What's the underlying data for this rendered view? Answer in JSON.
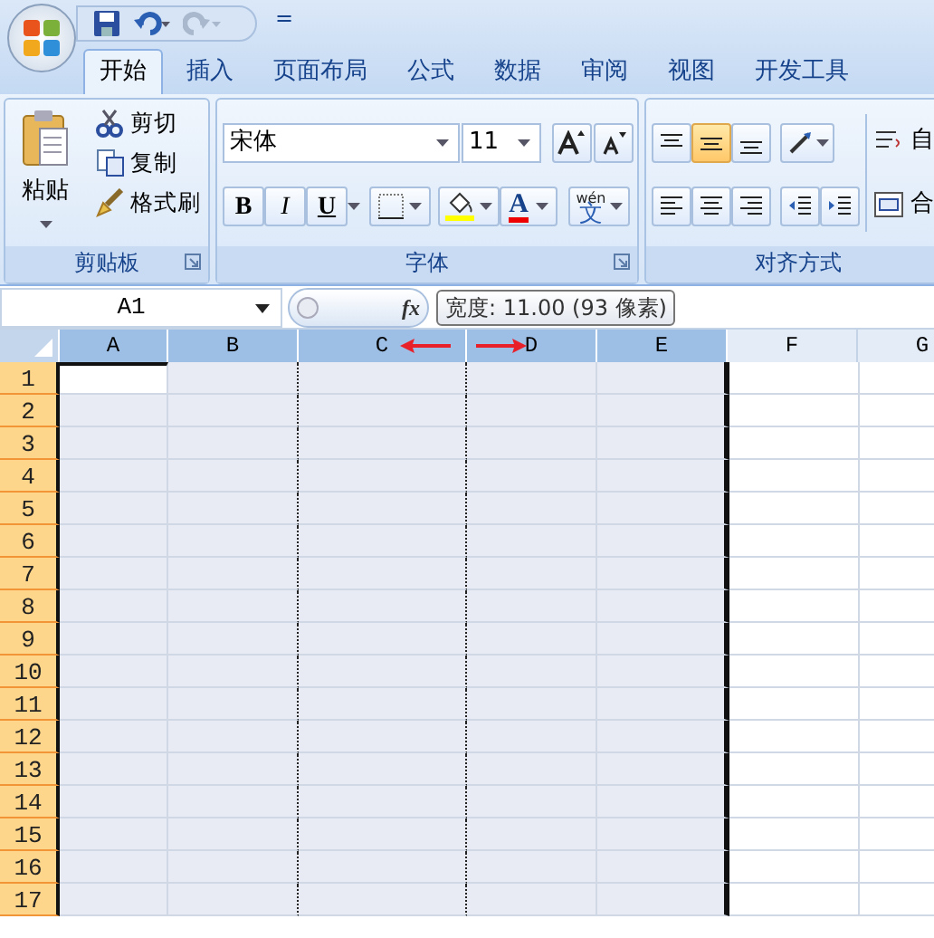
{
  "quick_access": {
    "overflow": "="
  },
  "tabs": [
    {
      "label": "开始",
      "selected": true
    },
    {
      "label": "插入",
      "selected": false
    },
    {
      "label": "页面布局",
      "selected": false
    },
    {
      "label": "公式",
      "selected": false
    },
    {
      "label": "数据",
      "selected": false
    },
    {
      "label": "审阅",
      "selected": false
    },
    {
      "label": "视图",
      "selected": false
    },
    {
      "label": "开发工具",
      "selected": false
    }
  ],
  "clipboard": {
    "paste": "粘贴",
    "commands": [
      "剪切",
      "复制",
      "格式刷"
    ],
    "label": "剪贴板"
  },
  "font": {
    "name": "宋体",
    "size": "11",
    "styles": [
      "B",
      "I",
      "U"
    ],
    "color_label": "A",
    "phonetic": "wén",
    "phonetic_char": "文",
    "label": "字体"
  },
  "alignment": {
    "vertical": [
      {
        "selected": false
      },
      {
        "selected": true
      },
      {
        "selected": false
      }
    ],
    "wrap": "自",
    "merge": "合",
    "label": "对齐方式"
  },
  "formula_bar": {
    "name_box": "A1",
    "fx": "fx",
    "tooltip": "宽度: 11.00 (93 像素)"
  },
  "columns": [
    {
      "label": "A",
      "selected": true,
      "active": true
    },
    {
      "label": "B",
      "selected": true,
      "active": false
    },
    {
      "label": "C",
      "selected": true,
      "active": false
    },
    {
      "label": "D",
      "selected": true,
      "active": false
    },
    {
      "label": "E",
      "selected": true,
      "active": false
    },
    {
      "label": "F",
      "selected": false,
      "active": false
    },
    {
      "label": "G",
      "selected": false,
      "active": false
    }
  ],
  "rows": [
    {
      "label": "1",
      "active": true
    },
    {
      "label": "2",
      "active": false
    },
    {
      "label": "3",
      "active": false
    },
    {
      "label": "4",
      "active": false
    },
    {
      "label": "5",
      "active": false
    },
    {
      "label": "6",
      "active": false
    },
    {
      "label": "7",
      "active": false
    },
    {
      "label": "8",
      "active": false
    },
    {
      "label": "9",
      "active": false
    },
    {
      "label": "10",
      "active": false
    },
    {
      "label": "11",
      "active": false
    },
    {
      "label": "12",
      "active": false
    },
    {
      "label": "13",
      "active": false
    },
    {
      "label": "14",
      "active": false
    },
    {
      "label": "15",
      "active": false
    },
    {
      "label": "16",
      "active": false
    },
    {
      "label": "17",
      "active": false
    }
  ]
}
